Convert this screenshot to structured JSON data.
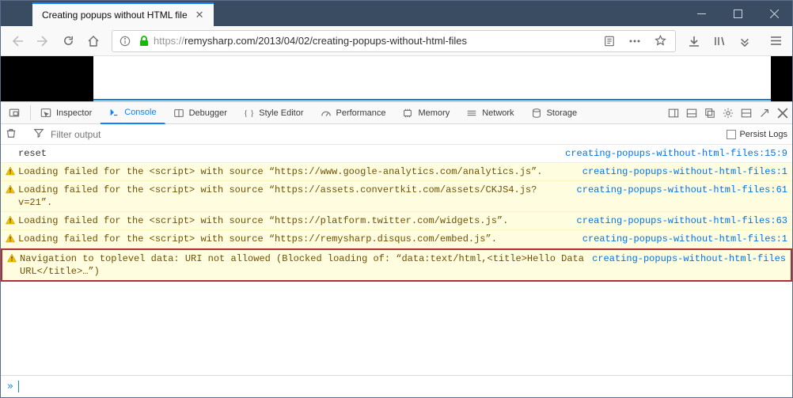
{
  "tab": {
    "title": "Creating popups without HTML file"
  },
  "url": {
    "protocol": "https://",
    "rest": "remysharp.com/2013/04/02/creating-popups-without-html-files"
  },
  "devtools": {
    "tabs": [
      "Inspector",
      "Console",
      "Debugger",
      "Style Editor",
      "Performance",
      "Memory",
      "Network",
      "Storage"
    ],
    "active": 1
  },
  "filter": {
    "placeholder": "Filter output",
    "persist_label": "Persist Logs"
  },
  "rows": [
    {
      "type": "out",
      "msg": "reset",
      "src": "creating-popups-without-html-files:15:9"
    },
    {
      "type": "warn",
      "msg": "Loading failed for the <script> with source “https://www.google-analytics.com/analytics.js”.",
      "src": "creating-popups-without-html-files:1"
    },
    {
      "type": "warn",
      "msg": "Loading failed for the <script> with source “https://assets.convertkit.com/assets/CKJS4.js?v=21”.",
      "src": "creating-popups-without-html-files:61"
    },
    {
      "type": "warn",
      "msg": "Loading failed for the <script> with source “https://platform.twitter.com/widgets.js”.",
      "src": "creating-popups-without-html-files:63"
    },
    {
      "type": "warn",
      "msg": "Loading failed for the <script> with source “https://remysharp.disqus.com/embed.js”.",
      "src": "creating-popups-without-html-files:1"
    },
    {
      "type": "warn-hi",
      "msg": "Navigation to toplevel data: URI not allowed (Blocked loading of: “data:text/html,<title>Hello Data URL</title>…”)",
      "src": "creating-popups-without-html-files"
    }
  ]
}
